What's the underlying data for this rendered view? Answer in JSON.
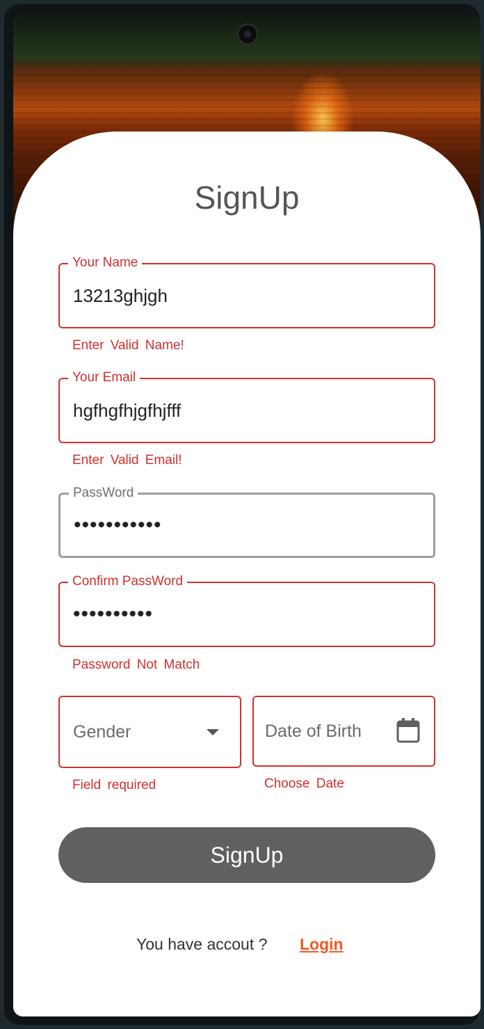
{
  "title": "SignUp",
  "name_field": {
    "label": "Your Name",
    "value": "13213ghjgh",
    "error": "Enter  Valid  Name!"
  },
  "email_field": {
    "label": "Your Email",
    "value": "hgfhgfhjgfhjfff",
    "error": "Enter  Valid  Email!"
  },
  "password_field": {
    "label": "PassWord",
    "value": "•••••••••••"
  },
  "confirm_password_field": {
    "label": "Confirm PassWord",
    "value": "••••••••••",
    "error": "Password  Not  Match"
  },
  "gender_field": {
    "placeholder": "Gender",
    "error": "Field required",
    "icon": "dropdown-arrow-icon"
  },
  "dob_field": {
    "placeholder": "Date of Birth",
    "error": "Choose  Date",
    "icon": "calendar-icon"
  },
  "signup_button": "SignUp",
  "footer": {
    "prompt": "You have accout ?",
    "login_link": "Login"
  },
  "colors": {
    "error": "#d32f2f",
    "button": "#606060",
    "link": "#ef5a24",
    "neutral_border": "#9e9e9e"
  }
}
